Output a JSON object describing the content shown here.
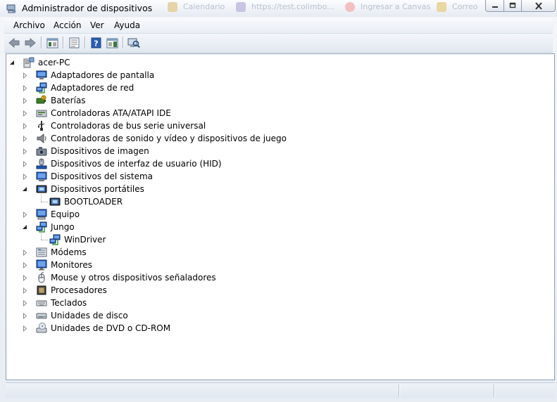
{
  "window": {
    "title": "Administrador de dispositivos"
  },
  "background_tabs": [
    "Calendario",
    "https://test.colimbo...",
    "Ingresar a Canvas",
    "Correo"
  ],
  "menu": [
    {
      "label": "Archivo"
    },
    {
      "label": "Acción"
    },
    {
      "label": "Ver"
    },
    {
      "label": "Ayuda"
    }
  ],
  "tree": {
    "root": {
      "label": "acer-PC",
      "icon": "computer-icon"
    },
    "items": [
      {
        "label": "Adaptadores de pantalla",
        "icon": "display-adapter-icon",
        "expanded": false
      },
      {
        "label": "Adaptadores de red",
        "icon": "network-adapter-icon",
        "expanded": false
      },
      {
        "label": "Baterías",
        "icon": "battery-icon",
        "expanded": false
      },
      {
        "label": "Controladoras ATA/ATAPI IDE",
        "icon": "ide-controller-icon",
        "expanded": false
      },
      {
        "label": "Controladoras de bus serie universal",
        "icon": "usb-icon",
        "expanded": false
      },
      {
        "label": "Controladoras de sonido y vídeo y dispositivos de juego",
        "icon": "speaker-icon",
        "expanded": false
      },
      {
        "label": "Dispositivos de imagen",
        "icon": "camera-icon",
        "expanded": false
      },
      {
        "label": "Dispositivos de interfaz de usuario (HID)",
        "icon": "hid-icon",
        "expanded": false
      },
      {
        "label": "Dispositivos del sistema",
        "icon": "system-device-icon",
        "expanded": false
      },
      {
        "label": "Dispositivos portátiles",
        "icon": "portable-device-icon",
        "expanded": true,
        "children": [
          {
            "label": "BOOTLOADER",
            "icon": "portable-device-icon"
          }
        ]
      },
      {
        "label": "Equipo",
        "icon": "computer-monitor-icon",
        "expanded": false
      },
      {
        "label": "Jungo",
        "icon": "network-adapter-icon",
        "expanded": true,
        "children": [
          {
            "label": "WinDriver",
            "icon": "network-adapter-icon"
          }
        ]
      },
      {
        "label": "Módems",
        "icon": "modem-icon",
        "expanded": false
      },
      {
        "label": "Monitores",
        "icon": "monitor-icon",
        "expanded": false
      },
      {
        "label": "Mouse y otros dispositivos señaladores",
        "icon": "mouse-icon",
        "expanded": false
      },
      {
        "label": "Procesadores",
        "icon": "processor-icon",
        "expanded": false
      },
      {
        "label": "Teclados",
        "icon": "keyboard-icon",
        "expanded": false
      },
      {
        "label": "Unidades de disco",
        "icon": "disk-drive-icon",
        "expanded": false
      },
      {
        "label": "Unidades de DVD o CD-ROM",
        "icon": "dvd-drive-icon",
        "expanded": false
      }
    ]
  },
  "colors": {
    "accent": "#1f5fb5",
    "pane_border": "#8e9fb5",
    "titlebar": "#eef2f7"
  }
}
